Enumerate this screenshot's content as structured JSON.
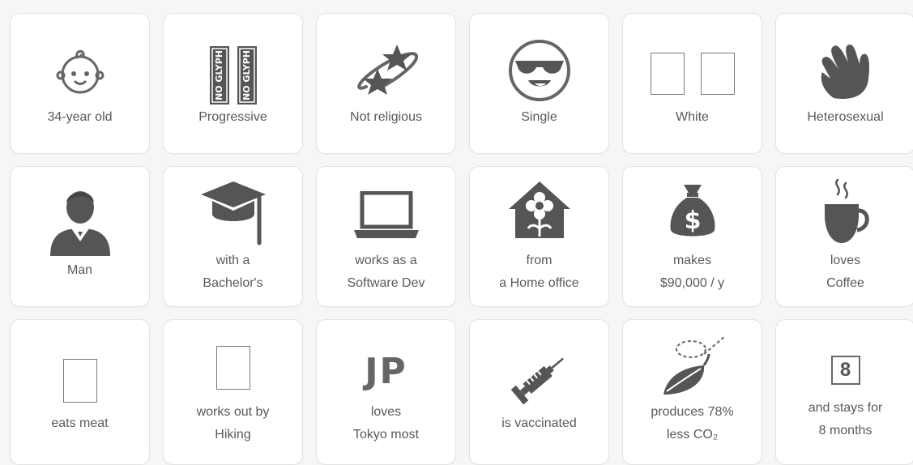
{
  "colors": {
    "icon": "#666666",
    "text": "#5a5a5a",
    "background": "#f7f6f4",
    "card": "#ffffff"
  },
  "cards": [
    {
      "icon": "baby-face-icon",
      "lines": [
        "34-year old"
      ]
    },
    {
      "icon": "missing-glyph-icon",
      "glyph_text": "NO GLYPH",
      "lines": [
        "Progressive"
      ]
    },
    {
      "icon": "stars-orbit-icon",
      "lines": [
        "Not religious"
      ]
    },
    {
      "icon": "sunglasses-face-icon",
      "lines": [
        "Single"
      ]
    },
    {
      "icon": "empty-glyph-box-icon",
      "lines": [
        "White"
      ]
    },
    {
      "icon": "waving-hand-icon",
      "lines": [
        "Heterosexual"
      ]
    },
    {
      "icon": "man-silhouette-icon",
      "lines": [
        "Man"
      ]
    },
    {
      "icon": "graduation-cap-icon",
      "lines": [
        "with a",
        "Bachelor's"
      ]
    },
    {
      "icon": "laptop-icon",
      "lines": [
        "works as a",
        "Software Dev"
      ]
    },
    {
      "icon": "house-flower-icon",
      "lines": [
        "from",
        "a Home office"
      ]
    },
    {
      "icon": "money-bag-icon",
      "lines": [
        "makes",
        "$90,000 / y"
      ]
    },
    {
      "icon": "coffee-cup-icon",
      "lines": [
        "loves",
        "Coffee"
      ]
    },
    {
      "icon": "empty-glyph-box-icon",
      "lines": [
        "eats meat"
      ]
    },
    {
      "icon": "empty-glyph-box-icon",
      "lines": [
        "works out by",
        "Hiking"
      ]
    },
    {
      "icon": "country-code-text",
      "code": "JP",
      "lines": [
        "loves",
        "Tokyo most"
      ]
    },
    {
      "icon": "syringe-icon",
      "lines": [
        "is vaccinated"
      ]
    },
    {
      "icon": "leaf-icon",
      "lines": [
        "produces 78%",
        "less CO₂"
      ]
    },
    {
      "icon": "calendar-number-icon",
      "number": "8",
      "lines": [
        "and stays for",
        "8 months"
      ]
    }
  ]
}
